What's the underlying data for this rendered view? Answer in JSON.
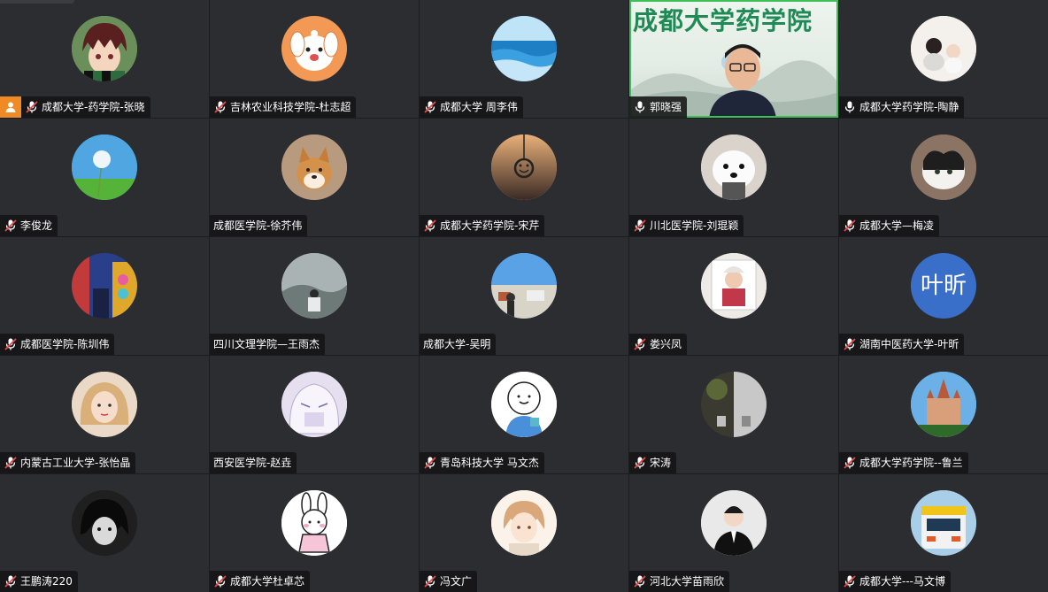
{
  "colors": {
    "background": "#1b1c1f",
    "tile": "#2c2d31",
    "speaker_outline": "#3fbf5a",
    "host_badge": "#f08a24",
    "video_title": "#1f8a55"
  },
  "active_video": {
    "banner_text": "成都大学药学院"
  },
  "participants": [
    {
      "name": "成都大学-药学院-张晓",
      "mic": "muted",
      "host": true,
      "avatar": "anime-boy"
    },
    {
      "name": "吉林农业科技学院-杜志超",
      "mic": "muted",
      "avatar": "cartoon-dog"
    },
    {
      "name": "成都大学 周李伟",
      "mic": "muted",
      "avatar": "ocean"
    },
    {
      "name": "郭晓强",
      "mic": "on",
      "avatar": "video"
    },
    {
      "name": "成都大学药学院-陶静",
      "mic": "on",
      "avatar": "mother-child"
    },
    {
      "name": "李俊龙",
      "mic": "muted",
      "avatar": "dandelion"
    },
    {
      "name": "成都医学院-徐芥伟",
      "mic": "none",
      "avatar": "shiba"
    },
    {
      "name": "成都大学药学院-宋芹",
      "mic": "muted",
      "avatar": "smiley-pendant"
    },
    {
      "name": "川北医学院-刘琨颖",
      "mic": "muted",
      "avatar": "white-dog"
    },
    {
      "name": "成都大学—梅凌",
      "mic": "muted",
      "avatar": "cat"
    },
    {
      "name": "成都医学院-陈圳伟",
      "mic": "muted",
      "avatar": "colorful-room"
    },
    {
      "name": "四川文理学院—王雨杰",
      "mic": "none",
      "avatar": "foggy-man"
    },
    {
      "name": "成都大学-吴明",
      "mic": "none",
      "avatar": "sky-town"
    },
    {
      "name": "娄兴凤",
      "mic": "muted",
      "avatar": "baby-photo"
    },
    {
      "name": "湖南中医药大学-叶昕",
      "mic": "muted",
      "avatar": "text",
      "avatar_text": "叶昕",
      "avatar_color": "#3a6fc9"
    },
    {
      "name": "内蒙古工业大学-张怡晶",
      "mic": "muted",
      "avatar": "girl"
    },
    {
      "name": "西安医学院-赵垚",
      "mic": "none",
      "avatar": "anime-sketch"
    },
    {
      "name": "青岛科技大学 马文杰",
      "mic": "muted",
      "avatar": "cartoon-cup"
    },
    {
      "name": "宋涛",
      "mic": "muted",
      "avatar": "forest-shoes"
    },
    {
      "name": "成都大学药学院--鲁兰",
      "mic": "muted",
      "avatar": "castle"
    },
    {
      "name": "王鹏涛220",
      "mic": "muted",
      "avatar": "dark-anime"
    },
    {
      "name": "成都大学杜卓芯",
      "mic": "muted",
      "avatar": "bunny-girl"
    },
    {
      "name": "冯文广",
      "mic": "muted",
      "avatar": "anime-boy-soft"
    },
    {
      "name": "河北大学苗雨欣",
      "mic": "muted",
      "avatar": "suit-man"
    },
    {
      "name": "成都大学---马文博",
      "mic": "muted",
      "avatar": "train"
    }
  ]
}
